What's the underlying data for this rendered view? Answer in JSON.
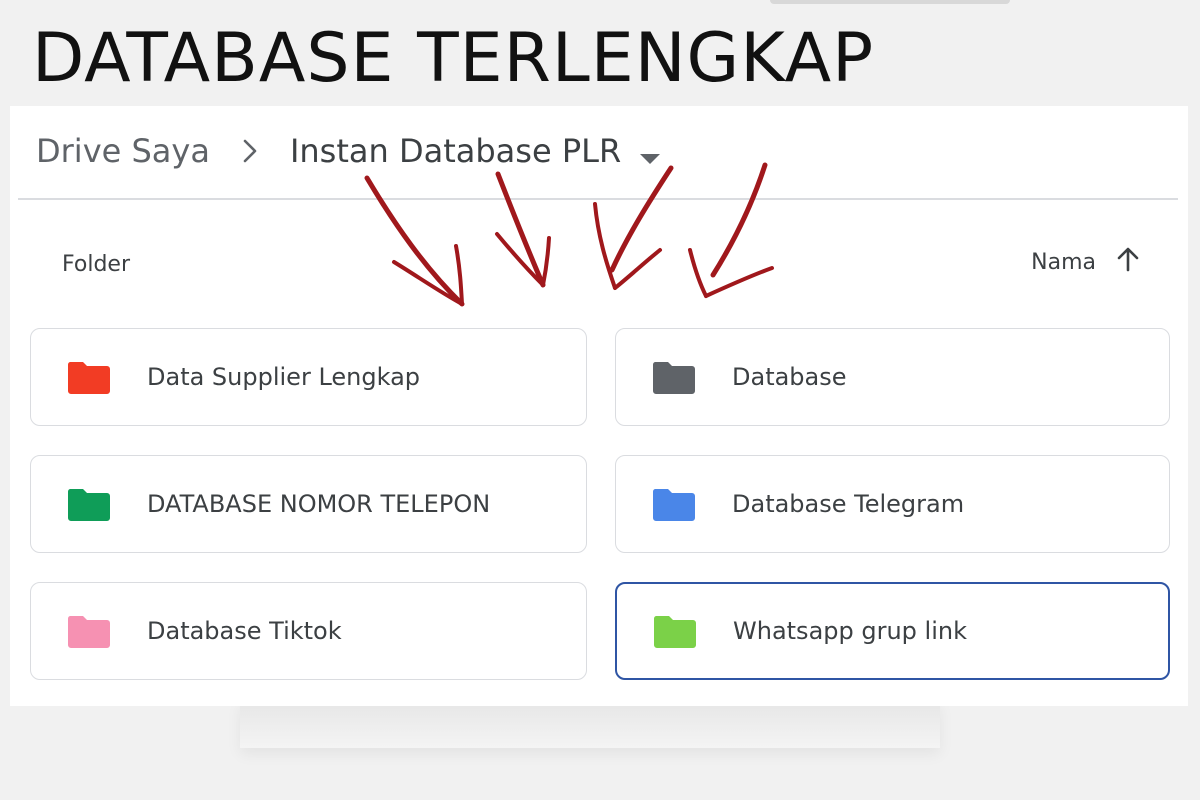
{
  "headline": "DATABASE TERLENGKAP",
  "breadcrumb": {
    "root": "Drive Saya",
    "separator_icon": "chevron-right-icon",
    "current": "Instan Database PLR",
    "caret_icon": "caret-down-icon"
  },
  "section": {
    "label": "Folder"
  },
  "sort": {
    "label": "Nama",
    "icon": "arrow-up-icon"
  },
  "colors": {
    "selected_border": "#2f55a4",
    "annotation_arrows": "#a0181c"
  },
  "folders": [
    {
      "name": "Data Supplier Lengkap",
      "color": "#f23c24",
      "icon": "folder-icon"
    },
    {
      "name": "Database",
      "color": "#5f6368",
      "icon": "folder-icon"
    },
    {
      "name": "DATABASE NOMOR TELEPON",
      "color": "#0f9d58",
      "icon": "folder-icon"
    },
    {
      "name": "Database Telegram",
      "color": "#4a86e8",
      "icon": "folder-icon"
    },
    {
      "name": "Database Tiktok",
      "color": "#f691b2",
      "icon": "folder-icon"
    },
    {
      "name": "Whatsapp grup link",
      "color": "#7bd148",
      "icon": "folder-icon",
      "selected": true
    }
  ]
}
